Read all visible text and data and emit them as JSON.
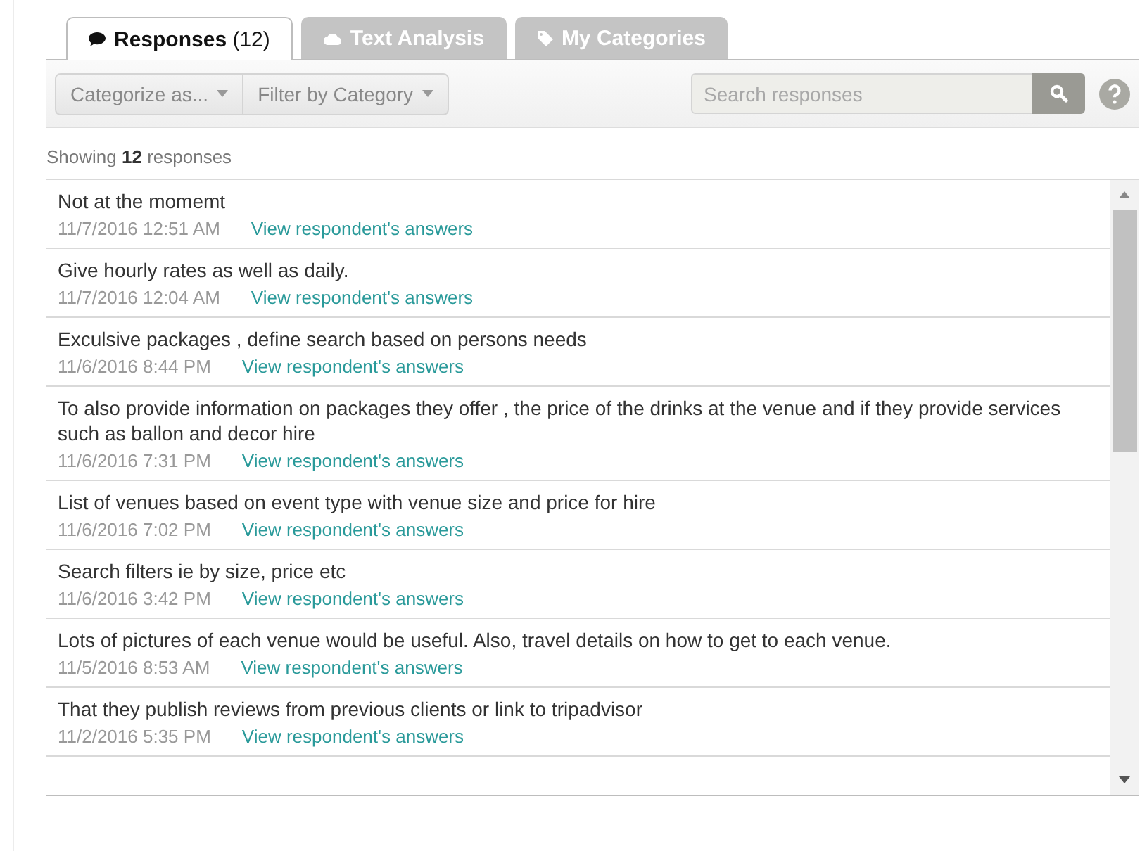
{
  "tabs": [
    {
      "label": "**Responses** (12)",
      "selected": true
    },
    {
      "label": "Text Analysis",
      "selected": false
    },
    {
      "label": "My Categories",
      "selected": false
    }
  ],
  "toolbar": {
    "buttons": [
      "Categorize as...",
      "Filter by Category"
    ],
    "search": {
      "placeholder": "Search responses"
    }
  },
  "summary": "Showing **12** responses",
  "responses": [
    {
      "text": "Not at the momemt",
      "date": "11/7/2016 12:51 AM",
      "link": "View respondent's answers"
    },
    {
      "text": "Give hourly rates as well as daily.",
      "date": "11/7/2016 12:04 AM",
      "link": "View respondent's answers"
    },
    {
      "text": "Exculsive packages , define search based on persons needs",
      "date": "11/6/2016 8:44 PM",
      "link": "View respondent's answers"
    },
    {
      "text": "To also provide information on packages they offer , the price of the drinks at the venue and if they provide services such as ballon and decor hire",
      "date": "11/6/2016 7:31 PM",
      "link": "View respondent's answers"
    },
    {
      "text": "List of venues based on event type with venue size and price for hire",
      "date": "11/6/2016 7:02 PM",
      "link": "View respondent's answers"
    },
    {
      "text": "Search filters ie by size, price etc",
      "date": "11/6/2016 3:42 PM",
      "link": "View respondent's answers"
    },
    {
      "text": "Lots of pictures of each venue would be useful. Also, travel details on how to get to each venue.",
      "date": "11/5/2016 8:53 AM",
      "link": "View respondent's answers"
    },
    {
      "text": "That they publish reviews from previous clients or link to tripadvisor",
      "date": "11/2/2016 5:35 PM",
      "link": "View respondent's answers"
    }
  ]
}
